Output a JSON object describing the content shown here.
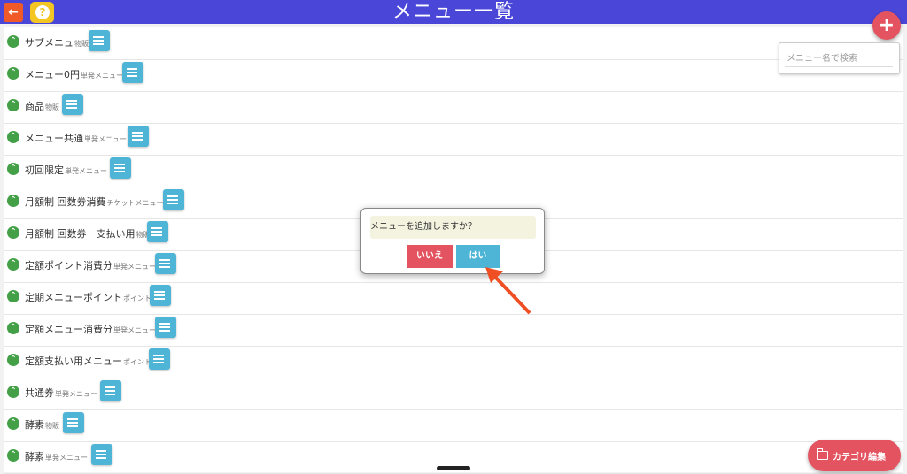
{
  "header": {
    "title": "メニュー一覧",
    "back_icon": "←",
    "help_icon": "?"
  },
  "search": {
    "placeholder": "メニュー名で検索",
    "value": ""
  },
  "menu_rows": [
    {
      "name": "サブメニュ",
      "tag": "物販"
    },
    {
      "name": "メニュー0円",
      "tag": "単発メニュー"
    },
    {
      "name": "商品",
      "tag": "物販"
    },
    {
      "name": "メニュー共通",
      "tag": "単発メニュー"
    },
    {
      "name": "初回限定",
      "tag": "単発メニュー"
    },
    {
      "name": "月額制 回数券消費",
      "tag": "チケットメニュー"
    },
    {
      "name": "月額制 回数券　支払い用",
      "tag": "物販"
    },
    {
      "name": "定額ポイント消費分",
      "tag": "単発メニュー"
    },
    {
      "name": "定期メニューポイント",
      "tag": "ポイント"
    },
    {
      "name": "定額メニュー消費分",
      "tag": "単発メニュー"
    },
    {
      "name": "定額支払い用メニュー",
      "tag": "ポイント"
    },
    {
      "name": "共通券",
      "tag": "単発メニュー"
    },
    {
      "name": "酵素",
      "tag": "物販"
    },
    {
      "name": "酵素",
      "tag": "単発メニュー"
    }
  ],
  "dialog": {
    "message": "メニューを追加しますか？",
    "no_label": "いいえ",
    "yes_label": "はい"
  },
  "fab": {
    "add_icon": "+"
  },
  "category_button": {
    "label": "カテゴリ編集"
  },
  "colors": {
    "header": "#4a46d8",
    "accent_red": "#e35460",
    "accent_blue": "#4fb5d6",
    "chevron_green": "#43a047",
    "back_orange": "#f05a28",
    "help_yellow": "#f3c623"
  }
}
